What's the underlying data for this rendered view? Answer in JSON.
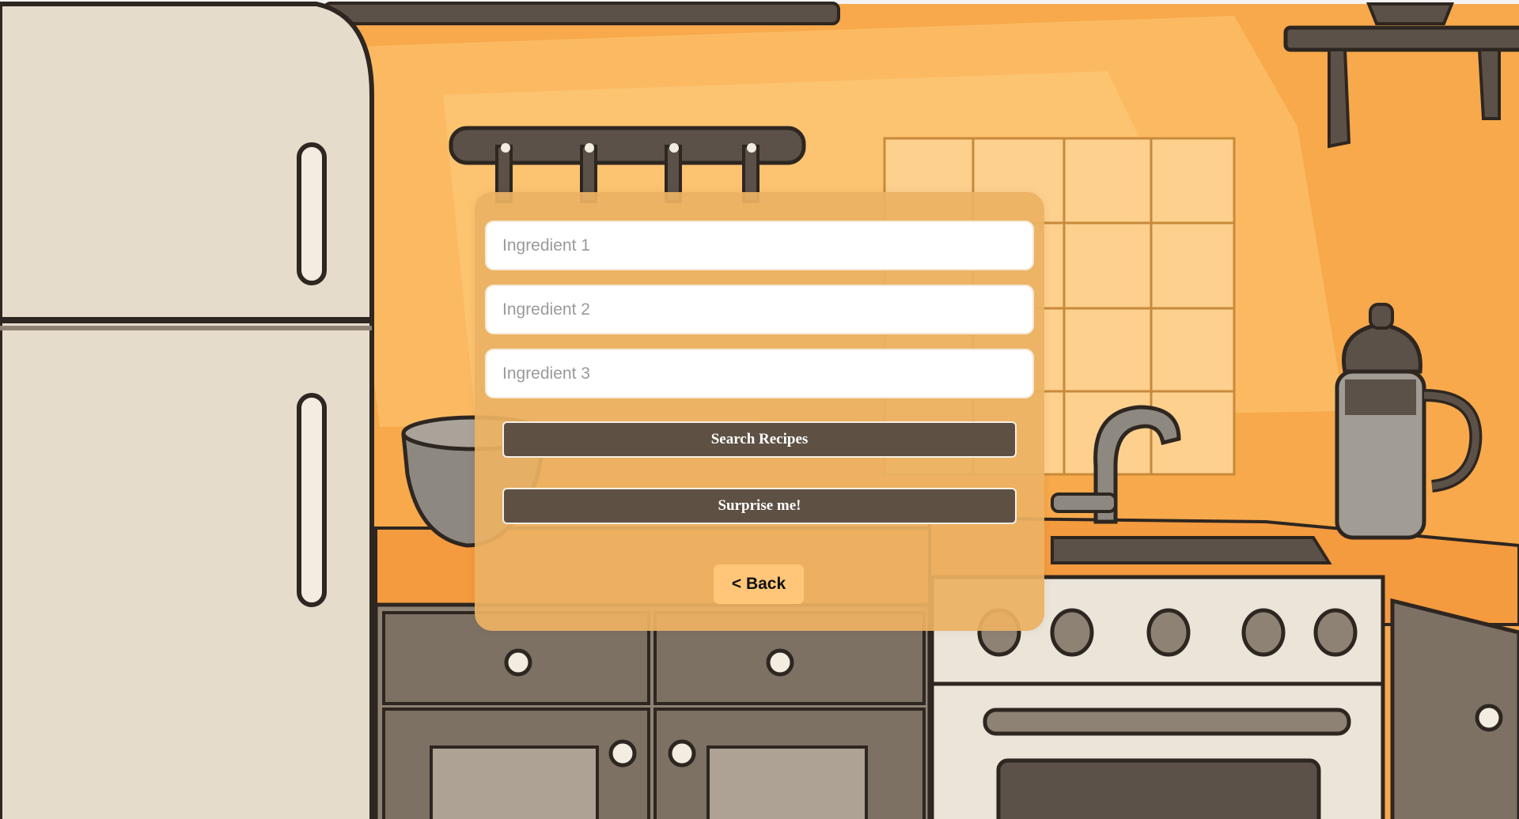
{
  "form": {
    "ingredient_1_placeholder": "Ingredient 1",
    "ingredient_2_placeholder": "Ingredient 2",
    "ingredient_3_placeholder": "Ingredient 3",
    "ingredient_1_value": "",
    "ingredient_2_value": "",
    "ingredient_3_value": "",
    "search_label": "Search Recipes",
    "surprise_label": "Surprise me!",
    "back_label": "< Back"
  },
  "colors": {
    "wall_orange": "#f6a84a",
    "panel": "#ecb263",
    "button_dark": "#5e5144",
    "back_button": "#ffc679",
    "fridge": "#e6dccc",
    "cabinet": "#8e8274"
  },
  "background": {
    "theme": "cartoon-kitchen-illustration",
    "items": [
      "refrigerator",
      "utensil-rack",
      "tiled-backsplash",
      "mixing-bowl",
      "sink-faucet",
      "stove-oven",
      "coffee-pot",
      "wall-shelf",
      "cabinets"
    ]
  }
}
